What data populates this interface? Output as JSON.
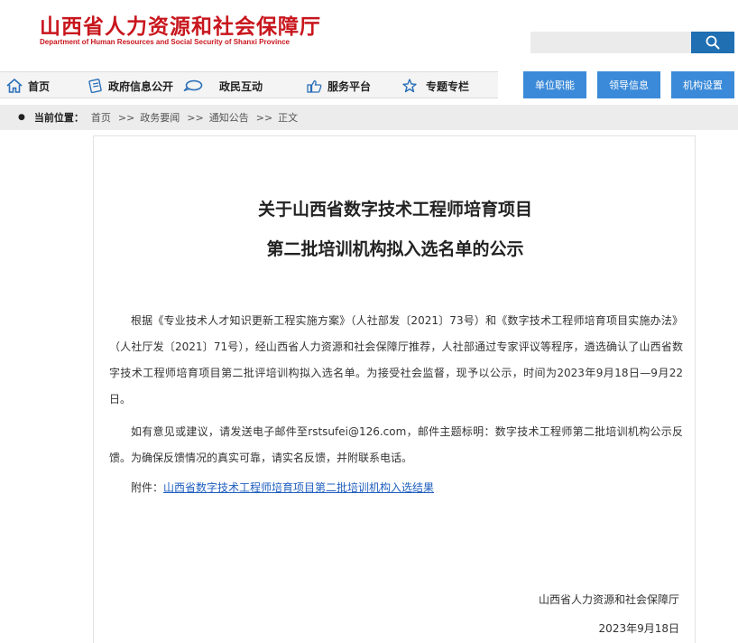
{
  "header": {
    "logo_cn": "山西省人力资源和社会保障厅",
    "logo_en": "Department of Human Resources and Social Security of Shanxi Province",
    "search_placeholder": "",
    "colors": {
      "brand_red": "#c8161d",
      "accent_blue": "#1f6fb2"
    }
  },
  "nav": {
    "items": [
      {
        "label": "首页",
        "icon": "home-icon"
      },
      {
        "label": "政府信息公开",
        "icon": "document-icon"
      },
      {
        "label": "政民互动",
        "icon": "chat-bubble-icon"
      },
      {
        "label": "服务平台",
        "icon": "thumbs-up-icon"
      },
      {
        "label": "专题专栏",
        "icon": "star-icon"
      }
    ],
    "buttons": [
      "单位职能",
      "领导信息",
      "机构设置"
    ]
  },
  "breadcrumb": {
    "label": "当前位置：",
    "items": [
      "首页",
      "政务要闻",
      "通知公告",
      "正文"
    ],
    "separator": ">>"
  },
  "article": {
    "title_line1": "关于山西省数字技术工程师培育项目",
    "title_line2": "第二批培训机构拟入选名单的公示",
    "para1": "根据《专业技术人才知识更新工程实施方案》（人社部发〔2021〕73号）和《数字技术工程师培育项目实施办法》（人社厅发〔2021〕71号），经山西省人力资源和社会保障厅推荐，人社部通过专家评议等程序，遴选确认了山西省数字技术工程师培育项目第二批评培训构拟入选名单。为接受社会监督，现予以公示，时间为2023年9月18日—9月22日。",
    "para2": "如有意见或建议，请发送电子邮件至rstsufei@126.com，邮件主题标明：数字技术工程师第二批培训机构公示反馈。为确保反馈情况的真实可靠，请实名反馈，并附联系电话。",
    "attachment_label": "附件：",
    "attachment_link": "山西省数字技术工程师培育项目第二批培训机构入选结果",
    "signature_org": "山西省人力资源和社会保障厅",
    "signature_date": "2023年9月18日"
  }
}
